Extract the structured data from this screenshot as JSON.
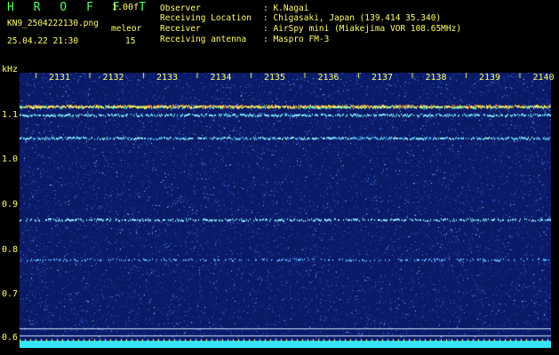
{
  "header": {
    "logo": "H R O F F T",
    "version": "1.00f",
    "filename": "KN9_2504222130.png",
    "datetime": "25.04.22 21:30",
    "meleor_label": "meleor",
    "meleor_count": "15",
    "fields": [
      {
        "label": "Observer",
        "value": ": K.Nagai"
      },
      {
        "label": "Receiving Location",
        "value": ": Chigasaki, Japan (139.414 35.340)"
      },
      {
        "label": "Receiver",
        "value": ": AirSpy mini (Miakejima VOR 108.65MHz)"
      },
      {
        "label": "Receiving antenna",
        "value": ": Maspro FM-3"
      }
    ]
  },
  "plot": {
    "y_unit": "kHz",
    "y_ticks": [
      "1.1",
      "1.0",
      "0.9",
      "0.8",
      "0.7",
      "0.6"
    ],
    "x_ticks": [
      "2131",
      "2132",
      "2133",
      "2134",
      "2135",
      "2136",
      "2137",
      "2138",
      "2139",
      "2140"
    ],
    "colors": {
      "background": "#0a1a66",
      "noise": "#2e6bd6",
      "signal": "#ffdd33",
      "footer": "#33e6ff"
    }
  }
}
